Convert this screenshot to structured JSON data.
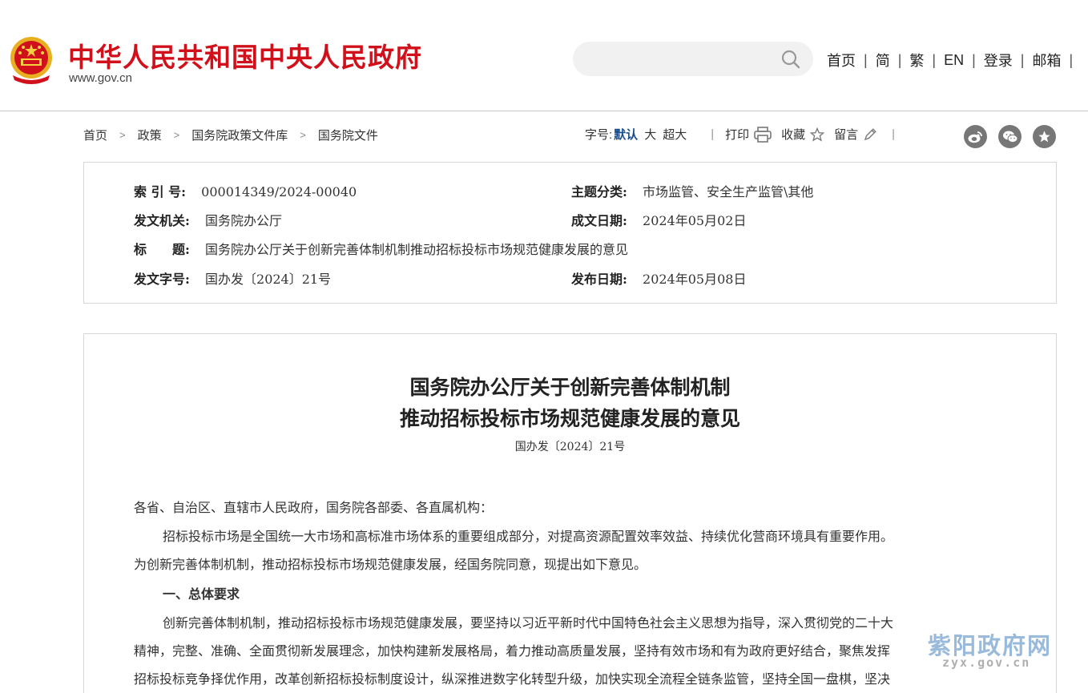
{
  "header": {
    "site_title": "中华人民共和国中央人民政府",
    "site_url": "www.gov.cn",
    "brand_color": "#d0111b",
    "search": {
      "placeholder": ""
    },
    "nav": [
      "首页",
      "简",
      "繁",
      "EN",
      "登录",
      "邮箱"
    ]
  },
  "breadcrumb": [
    "首页",
    "政策",
    "国务院政策文件库",
    "国务院文件"
  ],
  "toolbar": {
    "font_size_label": "字号:",
    "font_default": "默认",
    "font_large": "大",
    "font_xlarge": "超大",
    "print": "打印",
    "favorite": "收藏",
    "comment": "留言",
    "share_icons": [
      "weibo-icon",
      "wechat-icon",
      "star-icon"
    ]
  },
  "meta": {
    "index_label": "索 引 号:",
    "index_value": "000014349/2024-00040",
    "topic_label": "主题分类:",
    "topic_value": "市场监管、安全生产监管\\其他",
    "issuer_label": "发文机关:",
    "issuer_value": "国务院办公厅",
    "created_label": "成文日期:",
    "created_value": "2024年05月02日",
    "title_label": "标　　题:",
    "title_value": "国务院办公厅关于创新完善体制机制推动招标投标市场规范健康发展的意见",
    "docno_label": "发文字号:",
    "docno_value": "国办发〔2024〕21号",
    "published_label": "发布日期:",
    "published_value": "2024年05月08日"
  },
  "article": {
    "title_line1": "国务院办公厅关于创新完善体制机制",
    "title_line2": "推动招标投标市场规范健康发展的意见",
    "doc_number": "国办发〔2024〕21号",
    "salutation": "各省、自治区、直辖市人民政府，国务院各部委、各直属机构：",
    "para1_line1": "招标投标市场是全国统一大市场和高标准市场体系的重要组成部分，对提高资源配置效率效益、持续优化营商环境具有重要作用。",
    "para1_line2": "为创新完善体制机制，推动招标投标市场规范健康发展，经国务院同意，现提出如下意见。",
    "section1": "一、总体要求",
    "para2_line1": "创新完善体制机制，推动招标投标市场规范健康发展，要坚持以习近平新时代中国特色社会主义思想为指导，深入贯彻党的二十大",
    "para2_line2": "精神，完整、准确、全面贯彻新发展理念，加快构建新发展格局，着力推动高质量发展，坚持有效市场和有为政府更好结合，聚焦发挥",
    "para2_line3": "招标投标竞争择优作用，改革创新招标投标制度设计，纵深推进数字化转型升级，加快实现全流程全链条监管，坚持全国一盘棋，坚决"
  },
  "watermark": {
    "name": "紫阳政府网",
    "domain": "zyx.gov.cn"
  }
}
